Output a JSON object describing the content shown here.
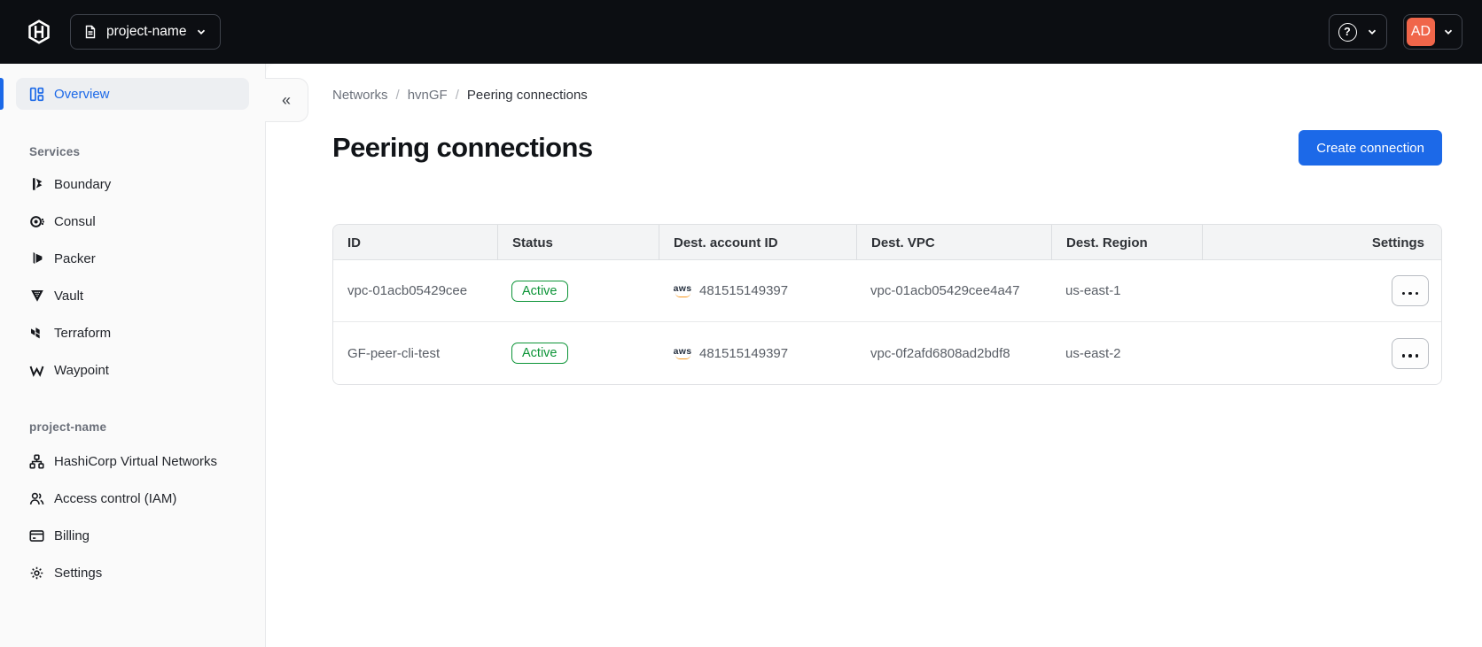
{
  "topbar": {
    "project_switcher_label": "project-name",
    "help_glyph": "?",
    "user_initials": "AD"
  },
  "sidebar": {
    "collapse_glyph": "«",
    "overview_label": "Overview",
    "overview_icon": "dashboard-icon",
    "sections": [
      {
        "label": "Services",
        "items": [
          {
            "label": "Boundary",
            "icon": "boundary-icon"
          },
          {
            "label": "Consul",
            "icon": "consul-icon"
          },
          {
            "label": "Packer",
            "icon": "packer-icon"
          },
          {
            "label": "Vault",
            "icon": "vault-icon"
          },
          {
            "label": "Terraform",
            "icon": "terraform-icon"
          },
          {
            "label": "Waypoint",
            "icon": "waypoint-icon"
          }
        ]
      },
      {
        "label": "project-name",
        "items": [
          {
            "label": "HashiCorp Virtual Networks",
            "icon": "network-icon"
          },
          {
            "label": "Access control (IAM)",
            "icon": "users-icon"
          },
          {
            "label": "Billing",
            "icon": "billing-icon"
          },
          {
            "label": "Settings",
            "icon": "gear-icon"
          }
        ]
      }
    ]
  },
  "breadcrumb": {
    "separator": "/",
    "items": [
      "Networks",
      "hvnGF",
      "Peering connections"
    ]
  },
  "page": {
    "title": "Peering connections",
    "create_button_label": "Create connection"
  },
  "table": {
    "aws_label": "aws",
    "columns": [
      "ID",
      "Status",
      "Dest. account ID",
      "Dest. VPC",
      "Dest. Region",
      "Settings"
    ],
    "rows": [
      {
        "id": "vpc-01acb05429cee",
        "status": "Active",
        "dest_account_id": "481515149397",
        "dest_vpc": "vpc-01acb05429cee4a47",
        "dest_region": "us-east-1"
      },
      {
        "id": "GF-peer-cli-test",
        "status": "Active",
        "dest_account_id": "481515149397",
        "dest_vpc": "vpc-0f2afd6808ad2bdf8",
        "dest_region": "us-east-2"
      }
    ]
  },
  "colors": {
    "accent": "#1c69e8",
    "success": "#0c9437",
    "avatar-bg": "#f0664a",
    "topbar-bg": "#0c0e12"
  }
}
